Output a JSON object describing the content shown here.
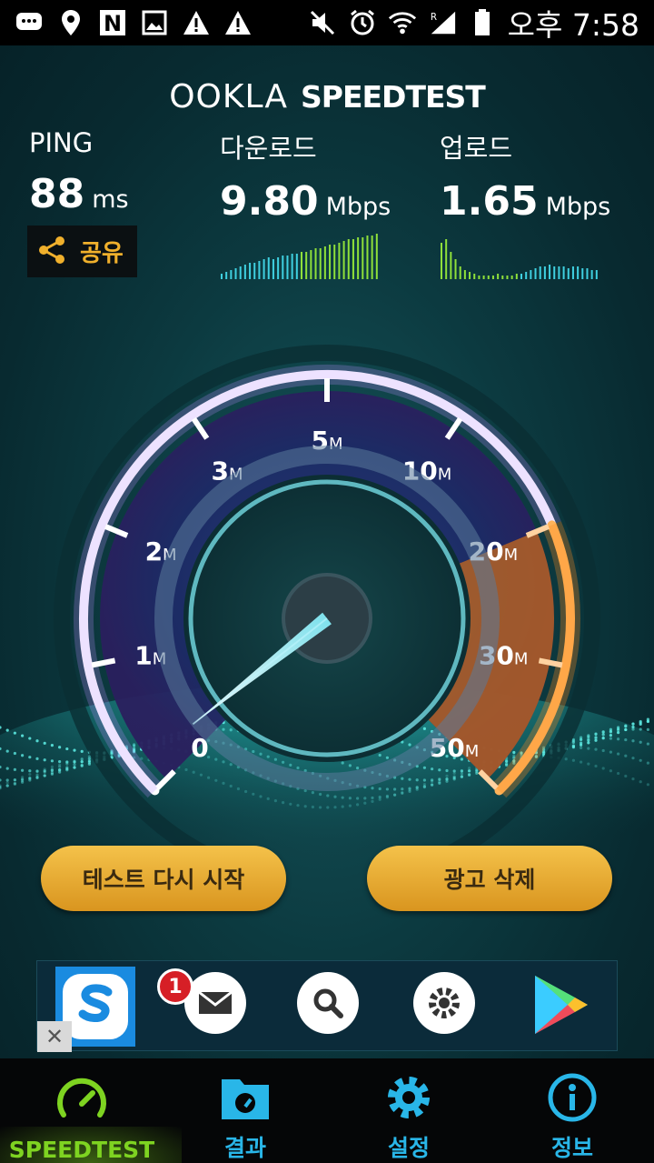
{
  "status_bar": {
    "time": "오후 7:58",
    "icons_left": [
      "chat-icon",
      "location-icon",
      "n-icon",
      "photo-icon",
      "warning-icon",
      "warning-icon"
    ],
    "icons_right": [
      "mute-icon",
      "alarm-icon",
      "wifi-icon",
      "signal-icon",
      "battery-icon"
    ]
  },
  "header": {
    "brand": "OOKLA",
    "product": "SPEEDTEST"
  },
  "results": {
    "ping": {
      "label": "PING",
      "value": "88",
      "unit": "ms"
    },
    "download": {
      "label": "다운로드",
      "value": "9.80",
      "unit": "Mbps"
    },
    "upload": {
      "label": "업로드",
      "value": "1.65",
      "unit": "Mbps"
    }
  },
  "share_button": {
    "label": "공유"
  },
  "gauge": {
    "labels": [
      {
        "num": "0",
        "unit": ""
      },
      {
        "num": "1",
        "unit": "M"
      },
      {
        "num": "2",
        "unit": "M"
      },
      {
        "num": "3",
        "unit": "M"
      },
      {
        "num": "5",
        "unit": "M"
      },
      {
        "num": "10",
        "unit": "M"
      },
      {
        "num": "20",
        "unit": "M"
      },
      {
        "num": "30",
        "unit": "M"
      },
      {
        "num": "50",
        "unit": "M"
      }
    ],
    "needle_value_mbps": 0.2
  },
  "buttons": {
    "restart": "테스트 다시 시작",
    "remove_ads": "광고 삭제"
  },
  "ad": {
    "badge_count": "1",
    "close_label": "✕",
    "icons": [
      "s-app-icon",
      "mail-icon",
      "search-icon",
      "settings-icon",
      "play-store-icon"
    ]
  },
  "nav": [
    {
      "label": "SPEEDTEST",
      "icon": "speedometer-icon",
      "color": "#7ed321",
      "active": true
    },
    {
      "label": "결과",
      "icon": "results-folder-icon",
      "color": "#29b6e8",
      "active": false
    },
    {
      "label": "설정",
      "icon": "gear-icon",
      "color": "#29b6e8",
      "active": false
    },
    {
      "label": "정보",
      "icon": "info-icon",
      "color": "#29b6e8",
      "active": false
    }
  ],
  "colors": {
    "accent_orange": "#f0a030",
    "accent_green": "#7ed321",
    "accent_blue": "#29b6e8",
    "button_gold": "#e6a82a"
  }
}
